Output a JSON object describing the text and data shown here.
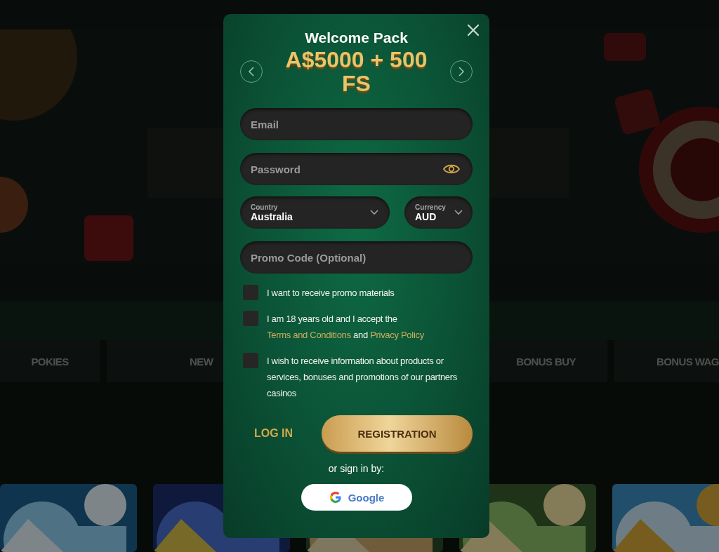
{
  "background": {
    "categories": [
      {
        "label": "POKIES"
      },
      {
        "label": "NEW"
      },
      {
        "label": "BONUS BUY"
      },
      {
        "label": "BONUS WAG"
      }
    ]
  },
  "modal": {
    "title": "Welcome Pack",
    "offer": "A$5000 + 500 FS",
    "fields": [
      {
        "kind": "text",
        "placeholder": "Email"
      },
      {
        "kind": "password",
        "placeholder": "Password"
      }
    ],
    "selects": [
      {
        "label": "Country",
        "value": "Australia"
      },
      {
        "label": "Currency",
        "value": "AUD"
      }
    ],
    "promo": {
      "placeholder": "Promo Code (Optional)"
    },
    "checkboxes": [
      {
        "checked": false,
        "parts": [
          {
            "kind": "text",
            "text": "I want to receive promo materials"
          }
        ]
      },
      {
        "checked": false,
        "parts": [
          {
            "kind": "text",
            "text": "I am 18 years old and I accept the "
          },
          {
            "kind": "link",
            "text": "Terms and Conditions"
          },
          {
            "kind": "text",
            "text": " and "
          },
          {
            "kind": "link",
            "text": "Privacy Policy"
          }
        ]
      },
      {
        "checked": false,
        "parts": [
          {
            "kind": "text",
            "text": "I wish to receive information about products or services, bonuses and promotions of our partners casinos"
          }
        ]
      }
    ],
    "login": "LOG IN",
    "register": "REGISTRATION",
    "or_sign_in": "or sign in by:",
    "google": "Google"
  }
}
